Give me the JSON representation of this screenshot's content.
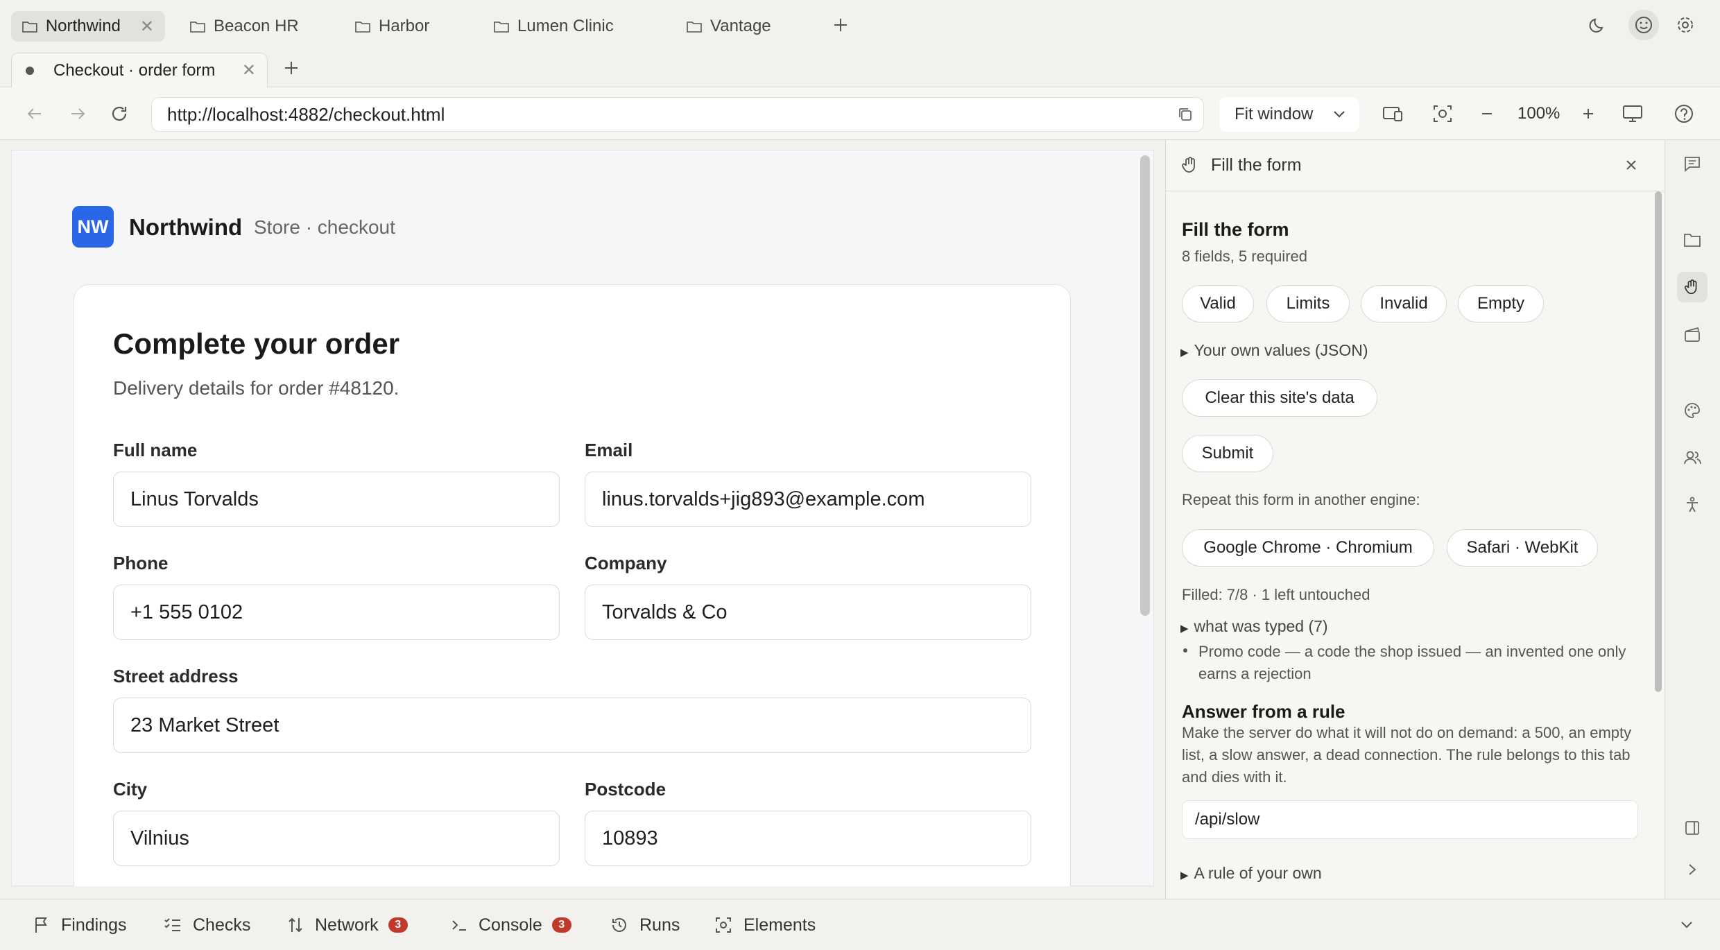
{
  "workspace_tabs": [
    {
      "label": "Northwind",
      "active": true
    },
    {
      "label": "Beacon HR"
    },
    {
      "label": "Harbor"
    },
    {
      "label": "Lumen Clinic"
    },
    {
      "label": "Vantage"
    }
  ],
  "page_tab": {
    "title": "Checkout · order form"
  },
  "toolbar": {
    "url": "http://localhost:4882/checkout.html",
    "fit_mode": "Fit window",
    "zoom_level": "100%"
  },
  "page": {
    "logo_text": "NW",
    "brand": "Northwind",
    "brand_sub": "Store · checkout",
    "heading": "Complete your order",
    "subheading": "Delivery details for order #48120.",
    "fields": {
      "full_name": {
        "label": "Full name",
        "value": "Linus Torvalds"
      },
      "email": {
        "label": "Email",
        "value": "linus.torvalds+jig893@example.com"
      },
      "phone": {
        "label": "Phone",
        "value": "+1 555 0102"
      },
      "company": {
        "label": "Company",
        "value": "Torvalds & Co"
      },
      "street": {
        "label": "Street address",
        "value": "23 Market Street"
      },
      "city": {
        "label": "City",
        "value": "Vilnius"
      },
      "postcode": {
        "label": "Postcode",
        "value": "10893"
      }
    }
  },
  "panel": {
    "title": "Fill the form",
    "section_title": "Fill the form",
    "summary": "8 fields, 5 required",
    "presets": [
      "Valid",
      "Limits",
      "Invalid",
      "Empty"
    ],
    "own_values": "Your own values (JSON)",
    "clear_label": "Clear this site's data",
    "submit_label": "Submit",
    "repeat_label": "Repeat this form in another engine:",
    "engines": [
      "Google Chrome · Chromium",
      "Safari · WebKit"
    ],
    "filled_status": "Filled: 7/8 · 1 left untouched",
    "typed_toggle": "what was typed (7)",
    "note": "Promo code — a code the shop issued — an invented one only earns a rejection",
    "rule_title": "Answer from a rule",
    "rule_desc": "Make the server do what it will not do on demand: a 500, an empty list, a slow answer, a dead connection. The rule belongs to this tab and dies with it.",
    "rule_value": "/api/slow",
    "rule_own": "A rule of your own"
  },
  "bottom_tabs": [
    {
      "label": "Findings"
    },
    {
      "label": "Checks"
    },
    {
      "label": "Network",
      "badge": "3"
    },
    {
      "label": "Console",
      "badge": "3"
    },
    {
      "label": "Runs"
    },
    {
      "label": "Elements"
    }
  ]
}
